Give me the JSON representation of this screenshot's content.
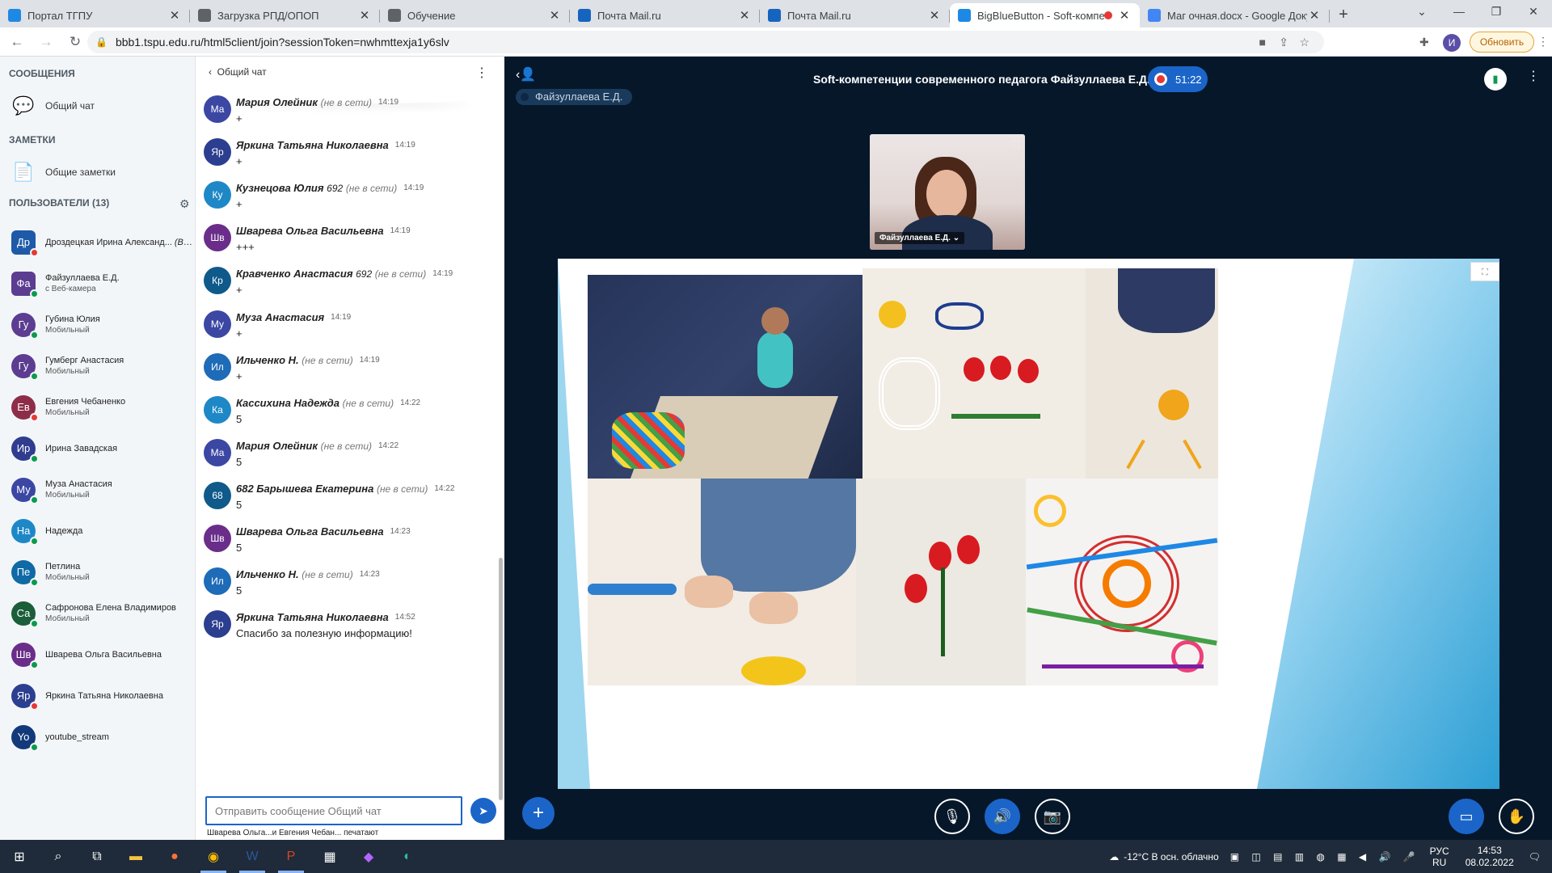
{
  "browser": {
    "tabs": [
      {
        "label": "Портал ТГПУ",
        "active": false
      },
      {
        "label": "Загрузка РПД/ОПОП",
        "active": false
      },
      {
        "label": "Обучение",
        "active": false
      },
      {
        "label": "Почта Mail.ru",
        "active": false
      },
      {
        "label": "Почта Mail.ru",
        "active": false
      },
      {
        "label": "BigBlueButton - Soft-компе",
        "active": true
      },
      {
        "label": "Маг очная.docx - Google Доку",
        "active": false
      }
    ],
    "url": "bbb1.tspu.edu.ru/html5client/join?sessionToken=nwhmttexja1y6slv",
    "profile_initial": "И",
    "update_label": "Обновить"
  },
  "sidebar": {
    "messages_title": "СООБЩЕНИЯ",
    "public_chat": "Общий чат",
    "notes_title": "ЗАМЕТКИ",
    "shared_notes": "Общие заметки",
    "users_title": "ПОЛЬЗОВАТЕЛИ (13)",
    "users": [
      {
        "initials": "Др",
        "name": "Дроздецкая Ирина Александ...",
        "suffix": "(Вы)",
        "sub": "",
        "color": "#1e5aa8",
        "status": "#e53935",
        "square": true
      },
      {
        "initials": "Фа",
        "name": "Файзуллаева Е.Д.",
        "suffix": "",
        "sub": "с Веб-камера",
        "color": "#5c3d91",
        "status": "#0b9a4b",
        "square": true
      },
      {
        "initials": "Гу",
        "name": "Губина Юлия",
        "suffix": "",
        "sub": "Мобильный",
        "color": "#5c3d91",
        "status": "#0b9a4b",
        "square": false
      },
      {
        "initials": "Гу",
        "name": "Гумберг Анастасия",
        "suffix": "",
        "sub": "Мобильный",
        "color": "#5c3d91",
        "status": "#0b9a4b",
        "square": false
      },
      {
        "initials": "Ев",
        "name": "Евгения Чебаненко",
        "suffix": "",
        "sub": "Мобильный",
        "color": "#8e2d4a",
        "status": "#e53935",
        "square": false
      },
      {
        "initials": "Ир",
        "name": "Ирина Завадская",
        "suffix": "",
        "sub": "",
        "color": "#2f3c8f",
        "status": "#0b9a4b",
        "square": false
      },
      {
        "initials": "Му",
        "name": "Муза Анастасия",
        "suffix": "",
        "sub": "Мобильный",
        "color": "#3b47a3",
        "status": "#0b9a4b",
        "square": false
      },
      {
        "initials": "На",
        "name": "Надежда",
        "suffix": "",
        "sub": "",
        "color": "#1e88c7",
        "status": "#0b9a4b",
        "square": false
      },
      {
        "initials": "Пе",
        "name": "Петлина",
        "suffix": "",
        "sub": "Мобильный",
        "color": "#0f6aa6",
        "status": "#0b9a4b",
        "square": false
      },
      {
        "initials": "Са",
        "name": "Сафронова Елена Владимиров",
        "suffix": "",
        "sub": "Мобильный",
        "color": "#1b5e3a",
        "status": "#0b9a4b",
        "square": false
      },
      {
        "initials": "Шв",
        "name": "Шварева Ольга Васильевна",
        "suffix": "",
        "sub": "",
        "color": "#6a2e8a",
        "status": "#0b9a4b",
        "square": false
      },
      {
        "initials": "Яр",
        "name": "Яркина Татьяна Николаевна",
        "suffix": "",
        "sub": "",
        "color": "#2c3e8f",
        "status": "#e53935",
        "square": false
      },
      {
        "initials": "Yo",
        "name": "youtube_stream",
        "suffix": "",
        "sub": "",
        "color": "#123a7a",
        "status": "#0b9a4b",
        "square": false
      }
    ]
  },
  "chat": {
    "back_label": "Общий чат",
    "messages": [
      {
        "initials": "Ма",
        "name": "Мария Олейник",
        "offline": "(не в сети)",
        "time": "14:19",
        "text": "+",
        "color": "#3b47a3"
      },
      {
        "initials": "Яр",
        "name": "Яркина Татьяна Николаевна",
        "offline": "",
        "time": "14:19",
        "text": "+",
        "color": "#2c3e8f"
      },
      {
        "initials": "Ку",
        "name": "Кузнецова Юлия",
        "num": "692",
        "offline": "(не в сети)",
        "time": "14:19",
        "text": "+",
        "color": "#1e88c7"
      },
      {
        "initials": "Шв",
        "name": "Шварева Ольга Васильевна",
        "offline": "",
        "time": "14:19",
        "text": "+++",
        "color": "#6a2e8a"
      },
      {
        "initials": "Кр",
        "name": "Кравченко Анастасия",
        "num": "692",
        "offline": "(не в сети)",
        "time": "14:19",
        "text": "+",
        "color": "#0f5a8a"
      },
      {
        "initials": "Му",
        "name": "Муза Анастасия",
        "offline": "",
        "time": "14:19",
        "text": "+",
        "color": "#3b47a3"
      },
      {
        "initials": "Ил",
        "name": "Ильченко Н.",
        "offline": "(не в сети)",
        "time": "14:19",
        "text": "+",
        "color": "#1e6bb8"
      },
      {
        "initials": "Ка",
        "name": "Кассихина Надежда",
        "offline": "(не в сети)",
        "time": "14:22",
        "text": "5",
        "color": "#1e88c7"
      },
      {
        "initials": "Ма",
        "name": "Мария Олейник",
        "offline": "(не в сети)",
        "time": "14:22",
        "text": "5",
        "color": "#3b47a3"
      },
      {
        "initials": "68",
        "name": "682 Барышева Екатерина",
        "offline": "(не в сети)",
        "time": "14:22",
        "text": "5",
        "color": "#0f5a8a"
      },
      {
        "initials": "Шв",
        "name": "Шварева Ольга Васильевна",
        "offline": "",
        "time": "14:23",
        "text": "5",
        "color": "#6a2e8a"
      },
      {
        "initials": "Ил",
        "name": "Ильченко Н.",
        "offline": "(не в сети)",
        "time": "14:23",
        "text": "5",
        "color": "#1e6bb8"
      },
      {
        "initials": "Яр",
        "name": "Яркина Татьяна Николаевна",
        "offline": "",
        "time": "14:52",
        "text": "Спасибо за полезную информацию!",
        "color": "#2c3e8f"
      }
    ],
    "input_placeholder": "Отправить сообщение Общий чат",
    "typing": "Шварева Ольга...и Евгения Чебан... печатают"
  },
  "meeting": {
    "title": "Soft-компетенции современного педагога Файзуллаева Е.Д.",
    "rec_time": "51:22",
    "presenter": "Файзуллаева Е.Д.",
    "webcam_label": "Файзуллаева Е.Д."
  },
  "taskbar": {
    "weather": "-12°C  В осн. облачно",
    "lang": "РУС",
    "lang2": "RU",
    "time": "14:53",
    "date": "08.02.2022"
  }
}
